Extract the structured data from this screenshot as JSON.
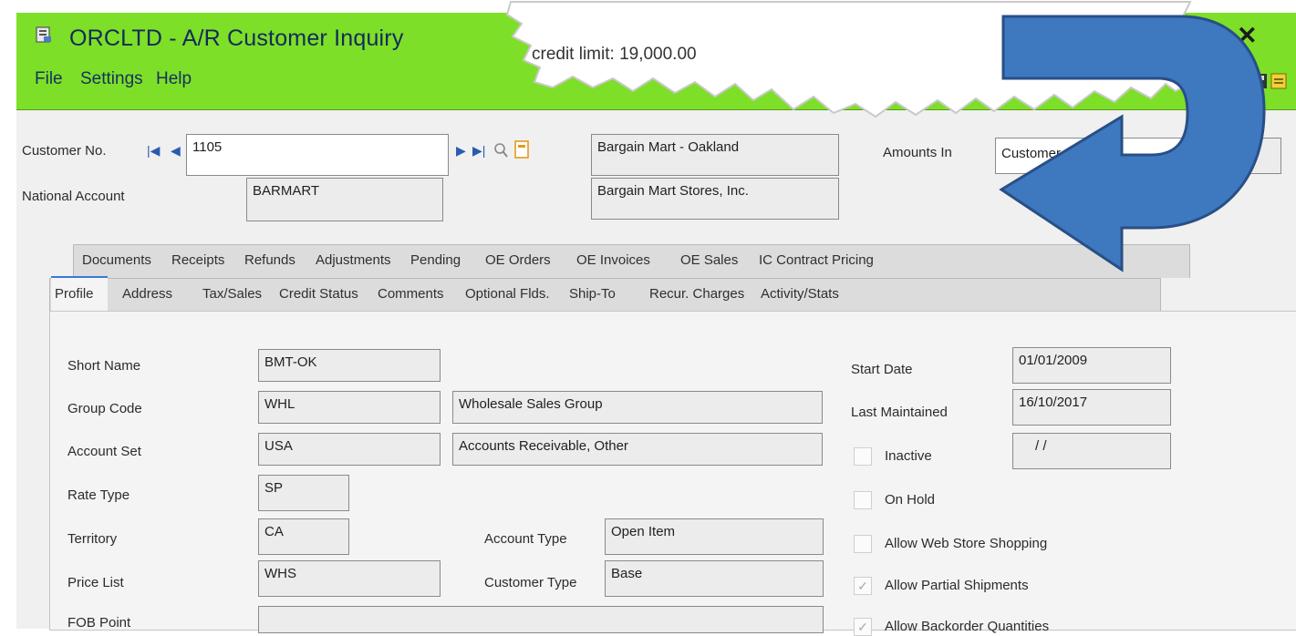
{
  "window": {
    "title": "ORCLTD - A/R Customer Inquiry",
    "close_label": "✕",
    "menu": [
      "File",
      "Settings",
      "Help"
    ]
  },
  "callout": {
    "text": "credit limit: 19,000.00"
  },
  "header": {
    "customer_no_label": "Customer No.",
    "customer_no": "1105",
    "customer_name": "Bargain Mart - Oakland",
    "amounts_in_label": "Amounts In",
    "amounts_in_value": "Customer Currency",
    "national_account_label": "National Account",
    "national_account": "BARMART",
    "national_account_name": "Bargain Mart Stores, Inc."
  },
  "tabs_back": [
    "Documents",
    "Receipts",
    "Refunds",
    "Adjustments",
    "Pending",
    "OE Orders",
    "OE Invoices",
    "OE Sales",
    "IC Contract Pricing"
  ],
  "tabs_front": [
    "Profile",
    "Address",
    "Tax/Sales",
    "Credit Status",
    "Comments",
    "Optional Flds.",
    "Ship-To",
    "Recur. Charges",
    "Activity/Stats"
  ],
  "profile": {
    "short_name_label": "Short Name",
    "short_name": "BMT-OK",
    "group_code_label": "Group Code",
    "group_code": "WHL",
    "group_code_desc": "Wholesale Sales Group",
    "account_set_label": "Account Set",
    "account_set": "USA",
    "account_set_desc": "Accounts Receivable, Other",
    "rate_type_label": "Rate Type",
    "rate_type": "SP",
    "territory_label": "Territory",
    "territory": "CA",
    "account_type_label": "Account Type",
    "account_type": "Open Item",
    "price_list_label": "Price List",
    "price_list": "WHS",
    "customer_type_label": "Customer Type",
    "customer_type": "Base",
    "fob_point_label": "FOB Point",
    "start_date_label": "Start Date",
    "start_date": "01/01/2009",
    "last_maintained_label": "Last Maintained",
    "last_maintained": "16/10/2017",
    "inactive_label": "Inactive",
    "inactive_date": "/ /",
    "on_hold_label": "On Hold",
    "allow_web_label": "Allow Web Store Shopping",
    "allow_partial_label": "Allow Partial Shipments",
    "allow_backorder_label": "Allow Backorder Quantities"
  },
  "checks": {
    "inactive": false,
    "on_hold": false,
    "allow_web": false,
    "allow_partial": true,
    "allow_backorder": true
  },
  "colors": {
    "titlebar": "#7ddf28",
    "arrow": "#3e78bf",
    "arrow_outline": "#284f86"
  }
}
